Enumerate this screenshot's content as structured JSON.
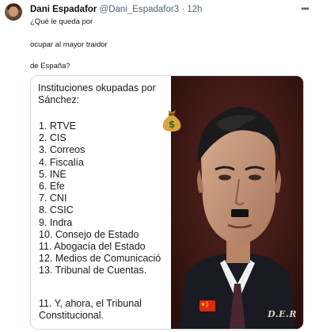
{
  "tweet": {
    "author_name": "Dani Espadafor",
    "author_handle": "@Dani_Espadafor3",
    "separator": "·",
    "time": "12h",
    "more_icon": "more-icon",
    "text_lines": [
      "¿Qué le queda por",
      "ocupar al mayor traidor",
      "de España?"
    ]
  },
  "media": {
    "title": "Instituciones okupadas por Sánchez:",
    "items": [
      "1. RTVE",
      "2. CIS",
      "3. Correos",
      "4. Fiscalía",
      "5. INE",
      "6. Efe",
      "7. CNI",
      "8. CSIC",
      "9. Indra",
      "10. Consejo de Estado",
      "11. Abogacía del Estado",
      "12. Medios de Comunicació",
      "13. Tribunal de Cuentas."
    ],
    "final_lines": [
      "11. Y, ahora, el Tribunal",
      "Constitucional."
    ],
    "signature": "D.E.R",
    "moneybag_symbol": "$",
    "icons": [
      "moneybag-emoji-icon",
      "china-flag-icon"
    ],
    "colors": {
      "background_right": "#3b1512",
      "text": "#1a1a1a",
      "secondary_text": "#536471"
    }
  }
}
